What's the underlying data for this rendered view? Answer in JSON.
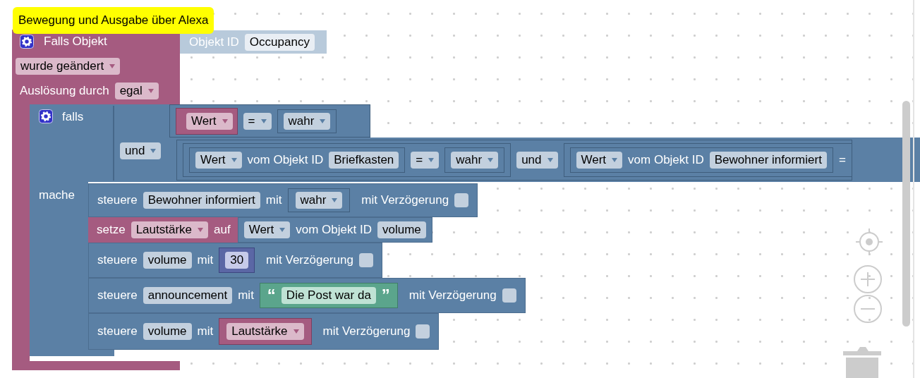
{
  "comment": {
    "text": "Bewegung und Ausgabe über Alexa"
  },
  "trigger": {
    "title": "Falls Objekt",
    "object": {
      "label": "Objekt ID",
      "id": "Occupancy"
    },
    "event": "wurde geändert",
    "cause_label": "Auslösung durch",
    "cause": "egal"
  },
  "if_block": {
    "title": "falls",
    "do_label": "mache",
    "operator": "und",
    "first": {
      "variable": "Wert",
      "op": "=",
      "value": "wahr"
    },
    "second": {
      "left": {
        "field": "Wert",
        "label": "vom Objekt ID",
        "id": "Briefkasten",
        "op": "=",
        "value": "wahr"
      },
      "operator": "und",
      "right": {
        "field": "Wert",
        "label": "vom Objekt ID",
        "id": "Bewohner informiert",
        "op": "="
      }
    }
  },
  "statements": [
    {
      "kind": "control",
      "label": "steuere",
      "target": "Bewohner informiert",
      "with": "mit",
      "value": {
        "kind": "bool",
        "text": "wahr"
      },
      "delay_label": "mit Verzögerung",
      "delay_checked": false
    },
    {
      "kind": "set",
      "label": "setze",
      "variable": "Lautstärke",
      "to": "auf",
      "value": {
        "field": "Wert",
        "label": "vom Objekt ID",
        "id": "volume"
      }
    },
    {
      "kind": "control",
      "label": "steuere",
      "target": "volume",
      "with": "mit",
      "value": {
        "kind": "number",
        "text": "30"
      },
      "delay_label": "mit Verzögerung",
      "delay_checked": false
    },
    {
      "kind": "control",
      "label": "steuere",
      "target": "announcement",
      "with": "mit",
      "value": {
        "kind": "text",
        "open_quote": "“",
        "text": "Die Post war da",
        "close_quote": "”"
      },
      "delay_label": "mit Verzögerung",
      "delay_checked": false
    },
    {
      "kind": "control",
      "label": "steuere",
      "target": "volume",
      "with": "mit",
      "value": {
        "kind": "variable",
        "text": "Lautstärke"
      },
      "delay_label": "mit Verzögerung",
      "delay_checked": false
    }
  ]
}
